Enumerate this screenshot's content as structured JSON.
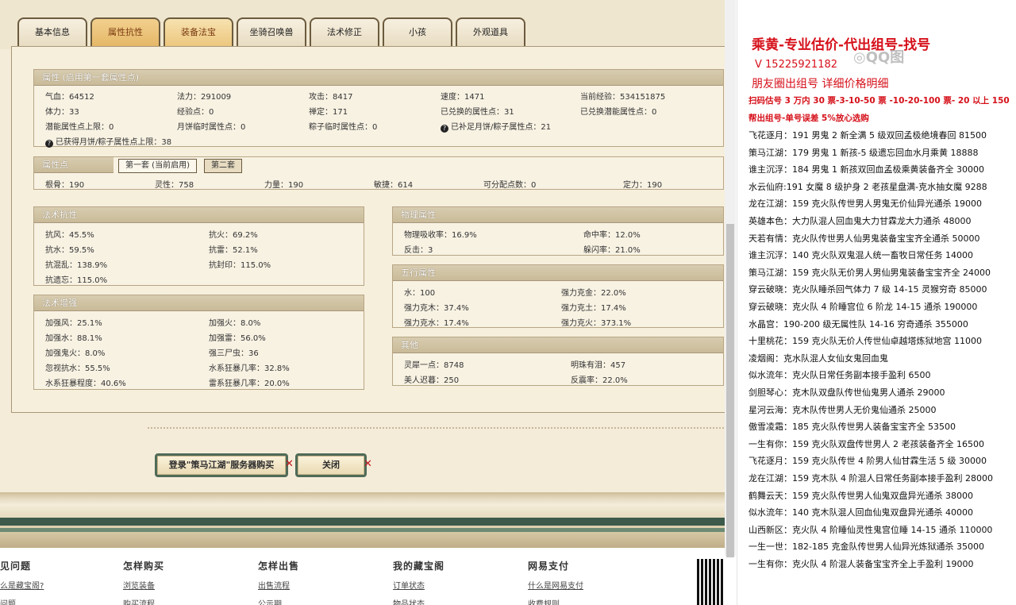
{
  "tabs": [
    "基本信息",
    "属性抗性",
    "装备法宝",
    "坐骑召唤兽",
    "法术修正",
    "小孩",
    "外观道具"
  ],
  "attr_panel": {
    "title": "属性 (启用第一套属性点)",
    "rows": [
      [
        "气血：64512",
        "法力：291009",
        "攻击：8417",
        "速度：1471",
        "当前经验：534151875"
      ],
      [
        "体力：33",
        "经验点：0",
        "禅定：171",
        "已兑换的属性点：31",
        "已兑换潜能属性点：0"
      ],
      [
        "潜能属性点上限：0",
        "月饼临时属性点：0",
        "粽子临时属性点：0",
        "已补足月饼/粽子属性点：21"
      ]
    ],
    "footer": "已获得月饼/粽子属性点上限：38"
  },
  "points_panel": {
    "title": "属性点",
    "subtab1": "第一套 (当前启用)",
    "subtab2": "第二套",
    "row": [
      "根骨：190",
      "灵性：758",
      "力量：190",
      "敏捷：614",
      "可分配点数：0",
      "定力：190"
    ]
  },
  "resist_panel": {
    "title": "法术抗性",
    "rows": [
      [
        "抗风：45.5%",
        "抗火：69.2%"
      ],
      [
        "抗水：59.5%",
        "抗雷：52.1%"
      ],
      [
        "抗混乱：138.9%",
        "抗封印：115.0%"
      ],
      [
        "抗遗忘：115.0%",
        ""
      ]
    ]
  },
  "enhance_panel": {
    "title": "法术增强",
    "rows": [
      [
        "加强风：25.1%",
        "加强火：8.0%"
      ],
      [
        "加强水：88.1%",
        "加强雷：56.0%"
      ],
      [
        "加强鬼火：8.0%",
        "强三尸虫：36"
      ],
      [
        "忽视抗水：55.5%",
        "水系狂暴几率：32.8%"
      ],
      [
        "水系狂暴程度：40.6%",
        "雷系狂暴几率：20.0%"
      ]
    ]
  },
  "physical_panel": {
    "title": "物理属性",
    "rows": [
      [
        "物理吸收率：16.9%",
        "命中率：12.0%"
      ],
      [
        "反击：3",
        "躲闪率：21.0%"
      ]
    ]
  },
  "five_panel": {
    "title": "五行属性",
    "rows": [
      [
        "水：100",
        "强力克金：22.0%"
      ],
      [
        "强力克木：37.4%",
        "强力克土：17.4%"
      ],
      [
        "强力克水：17.4%",
        "强力克火：373.1%"
      ]
    ]
  },
  "other_panel": {
    "title": "其他",
    "rows": [
      [
        "灵犀一点：8748",
        "明珠有泪：457"
      ],
      [
        "美人迟暮：250",
        "反震率：22.0%"
      ]
    ]
  },
  "buttons": {
    "login": "登录\"策马江湖\"服务器购买",
    "close": "关闭"
  },
  "footer": {
    "cols": [
      {
        "head": "见问题",
        "links": [
          "么是藏宝阁?",
          "问题"
        ]
      },
      {
        "head": "怎样购买",
        "links": [
          "浏览装备",
          "购买流程"
        ]
      },
      {
        "head": "怎样出售",
        "links": [
          "出售流程",
          "公示期"
        ]
      },
      {
        "head": "我的藏宝阁",
        "links": [
          "订单状态",
          "物品状态"
        ]
      },
      {
        "head": "网易支付",
        "links": [
          "什么是网易支付",
          "收费规则"
        ]
      }
    ]
  },
  "doc": {
    "title": "乘黄-专业估价-代出组号-找号",
    "phone": "V 15225921182",
    "sub": "朋友圈出组号   详细价格明细",
    "red1": "扫码估号 3 万内 30 票-3-10-50 票  -10-20-100 票- 20 以上 150",
    "red2": "帮出组号-单号误差 5%放心选购",
    "lines": [
      "飞花逐月：191 男鬼 2 新全满 5 级双回孟极绝境春回 81500",
      "策马江湖：179 男鬼 1 新孩-5 级遗忘回血水月乘黄 18888",
      "谁主沉浮：184 男鬼 1 新孩双回血孟极乘黄装备齐全 30000",
      "水云仙府:191 女魔 8 级护身 2 老孩星盘满-克水抽女魔 9288",
      "龙在江湖：159 克火队传世男人男鬼无价仙异光通杀 19000",
      "英雄本色：大力队混人回血鬼大力甘霖龙大力通杀 48000",
      "天若有情：克火队传世男人仙男鬼装备宝宝齐全通杀 50000",
      "谁主沉浮：140 克火队双鬼混人统一畜牧日常任务 14000",
      "策马江湖：159 克火队无价男人男仙男鬼装备宝宝齐全 24000",
      "穿云破晓：克火队睡杀回气体力 7 级 14-15 灵猴穷奇 85000",
      "穿云破晓：克火队 4 阶睡宫位 6 阶龙 14-15 通杀 190000",
      "水晶宫：190-200 级无属性队 14-16 穷奇通杀 355000",
      "十里桃花：159 克火队无价人传世仙卓越塔炼狱地宫 11000",
      "凌烟阁：克水队混人女仙女鬼回血鬼",
      "似水流年：克火队日常任务副本接手盈利 6500",
      "剑胆琴心：克木队双盘队传世仙鬼男人通杀 29000",
      "星河云海：克木队传世男人无价鬼仙通杀 25000",
      "傲雪凌霜：185 克火队传世男人装备宝宝齐全 53500",
      "一生有你：159 克火队双盘传世男人 2 老孩装备齐全 16500",
      "飞花逐月：159 克火队传世 4 阶男人仙甘霖生活 5 级 30000",
      "龙在江湖：159 克木队 4 阶混人日常任务副本接手盈利 28000",
      "鹤舞云天：159 克火队传世男人仙鬼双盘异光通杀 38000",
      "似水流年：140 克木队混人回血仙鬼双盘异光通杀 40000",
      "山西新区：克火队 4 阶睡仙灵性鬼宫位睡 14-15 通杀 110000",
      "一生一世：182-185 克金队传世男人仙异光炼狱通杀 35000",
      "一生有你：克火队 4 阶混人装备宝宝齐全上手盈利 19000"
    ]
  }
}
